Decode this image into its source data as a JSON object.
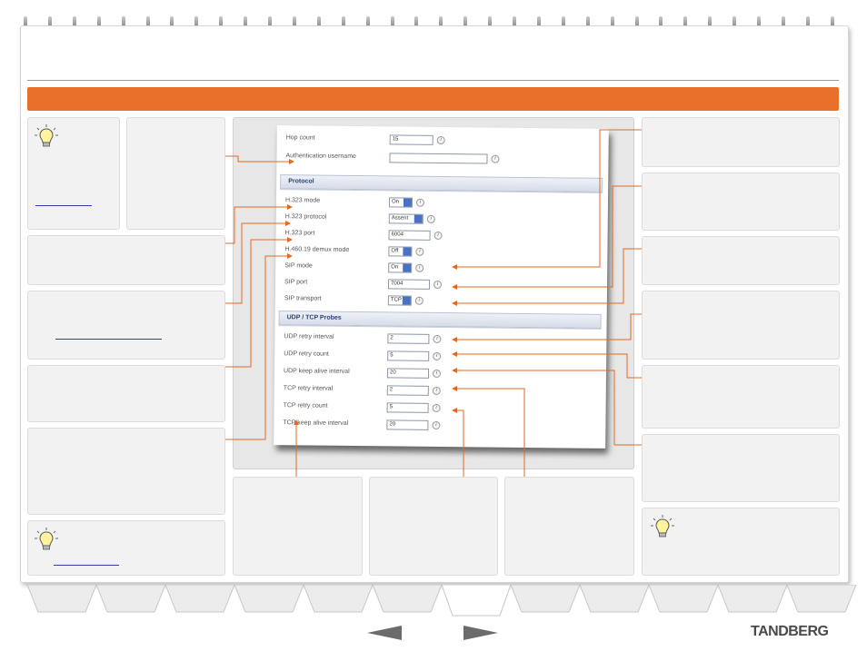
{
  "brand": {
    "name": "TANDBERG"
  },
  "sidebar_links": {
    "tip_top": "link",
    "middle": "link",
    "tip_bottom": "link"
  },
  "form": {
    "top_partial": {
      "label": "Hop count",
      "value": "15"
    },
    "auth_username": {
      "label": "Authentication username",
      "value": ""
    },
    "protocol_section": "Protocol",
    "protocol": [
      {
        "label": "H.323 mode",
        "value": "On",
        "kind": "select"
      },
      {
        "label": "H.323 protocol",
        "value": "Assent",
        "kind": "select"
      },
      {
        "label": "H.323 port",
        "value": "6004",
        "kind": "input"
      },
      {
        "label": "H.460.19 demux mode",
        "value": "Off",
        "kind": "select"
      },
      {
        "label": "SIP mode",
        "value": "On",
        "kind": "select"
      },
      {
        "label": "SIP port",
        "value": "7004",
        "kind": "input"
      },
      {
        "label": "SIP transport",
        "value": "TCP",
        "kind": "select"
      }
    ],
    "probes_section": "UDP / TCP Probes",
    "probes": [
      {
        "label": "UDP retry interval",
        "value": "2"
      },
      {
        "label": "UDP retry count",
        "value": "5"
      },
      {
        "label": "UDP keep alive interval",
        "value": "20"
      },
      {
        "label": "TCP retry interval",
        "value": "2"
      },
      {
        "label": "TCP retry count",
        "value": "5"
      },
      {
        "label": "TCP keep alive interval",
        "value": "20"
      }
    ]
  },
  "colors": {
    "accent": "#e8702a",
    "link": "#2a3ea8",
    "leader": "#e06a24"
  },
  "icons": {
    "tip": "lightbulb-icon",
    "info": "info-icon",
    "prev": "arrow-left-icon",
    "next": "arrow-right-icon"
  }
}
